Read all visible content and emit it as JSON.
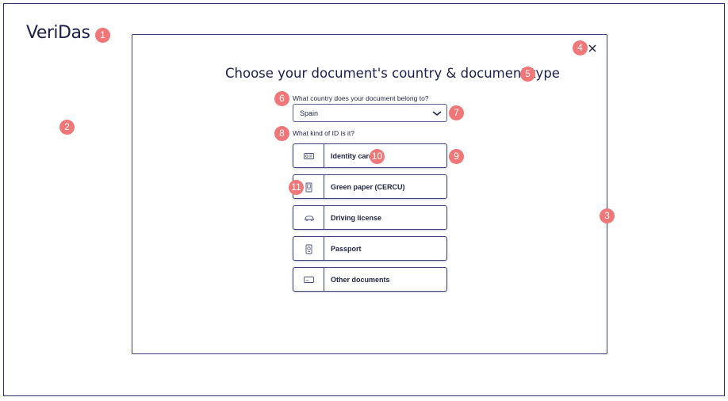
{
  "app": {
    "logo_text": "VeriDas"
  },
  "markers": [
    "1",
    "2",
    "3",
    "4",
    "5",
    "6",
    "7",
    "8",
    "9",
    "10",
    "11"
  ],
  "modal": {
    "title": "Choose your document's country & document type",
    "country_question": "What country does your document belong to?",
    "country_selected": "Spain",
    "id_question": "What kind of ID is it?",
    "options": [
      {
        "label": "Identity card",
        "icon": "id-card-icon"
      },
      {
        "label": "Green paper (CERCU)",
        "icon": "paper-document-icon"
      },
      {
        "label": "Driving license",
        "icon": "car-icon"
      },
      {
        "label": "Passport",
        "icon": "passport-icon"
      },
      {
        "label": "Other documents",
        "icon": "generic-card-icon"
      }
    ]
  },
  "colors": {
    "accent": "#f07777",
    "border": "#3f4477",
    "text": "#1f2340"
  }
}
